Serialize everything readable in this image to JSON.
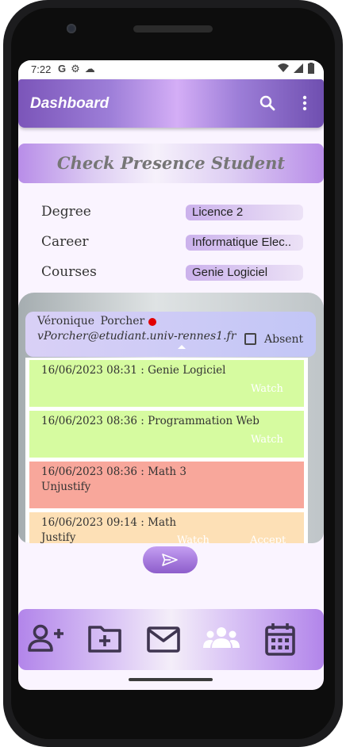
{
  "status_bar": {
    "time": "7:22",
    "left_icons": [
      "google-icon",
      "gear-icon",
      "cloud-icon"
    ],
    "right_icons": [
      "wifi-icon",
      "signal-icon",
      "battery-icon"
    ]
  },
  "app_bar": {
    "title": "Dashboard",
    "icons": [
      "search-icon",
      "more-vert-icon"
    ]
  },
  "banner": {
    "title": "Check Presence Student"
  },
  "fields": [
    {
      "label": "Degree",
      "value": "Licence 2"
    },
    {
      "label": "Career",
      "value": "Informatique Elec.."
    },
    {
      "label": "Courses",
      "value": "Genie Logiciel"
    }
  ],
  "student": {
    "name": "Véronique  Porcher",
    "email": "vPorcher@etudiant.univ-rennes1.fr",
    "absent_label": "Absent",
    "absent_checked": false,
    "status_color": "#e20000"
  },
  "entries": [
    {
      "line1": "16/06/2023 08:31 : Genie Logiciel",
      "line2": "",
      "watch": "Watch",
      "accept": "",
      "color": "#d6fba0"
    },
    {
      "line1": "16/06/2023 08:36 : Programmation Web",
      "line2": "",
      "watch": "Watch",
      "accept": "",
      "color": "#d6fba0"
    },
    {
      "line1": "16/06/2023 08:36 : Math 3",
      "line2": "Unjustify",
      "watch": "",
      "accept": "",
      "color": "#f8a79b"
    },
    {
      "line1": "16/06/2023 09:14 : Math",
      "line2": "Justify",
      "watch": "Watch",
      "accept": "Accept",
      "color": "#fde0b6"
    }
  ],
  "send_button": {
    "icon": "send-icon"
  },
  "bottom_nav": [
    "add-person-icon",
    "add-folder-icon",
    "mail-icon",
    "group-icon",
    "calendar-icon"
  ],
  "colors": {
    "accent": "#9d7ed8",
    "present": "#d6fba0",
    "unjustified": "#f8a79b",
    "justified": "#fde0b6"
  }
}
